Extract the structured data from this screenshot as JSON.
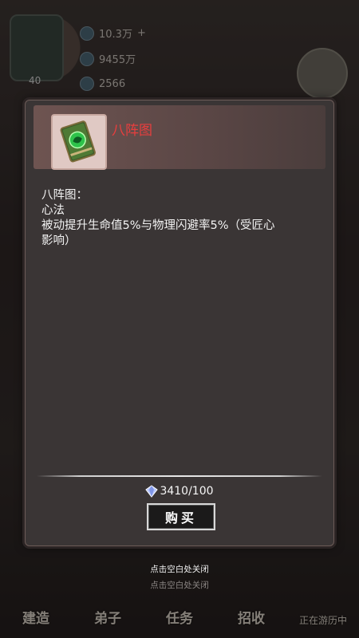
{
  "hud": {
    "currency1": "10.3万",
    "currency1_plus": "+",
    "currency2": "9455万",
    "currency3": "2566",
    "level": "40"
  },
  "bottom_nav": [
    {
      "label": "建造"
    },
    {
      "label": "弟子"
    },
    {
      "label": "任务"
    },
    {
      "label": "招收"
    },
    {
      "label": "正在游历中"
    }
  ],
  "dialog": {
    "item_name": "八阵图",
    "item_icon": "green-book-icon",
    "description_lines": [
      "八阵图：",
      "心法",
      "被动提升生命值5%与物理闪避率5%（受匠心",
      "影响）"
    ],
    "price_text": "3410/100",
    "price_icon": "gem-icon",
    "buy_label": "购买"
  },
  "close_hint": "点击空白处关闭",
  "colors": {
    "item_name": "#e83e3e",
    "dialog_bg": "#3a3535",
    "header_bg": "#6e5451"
  }
}
